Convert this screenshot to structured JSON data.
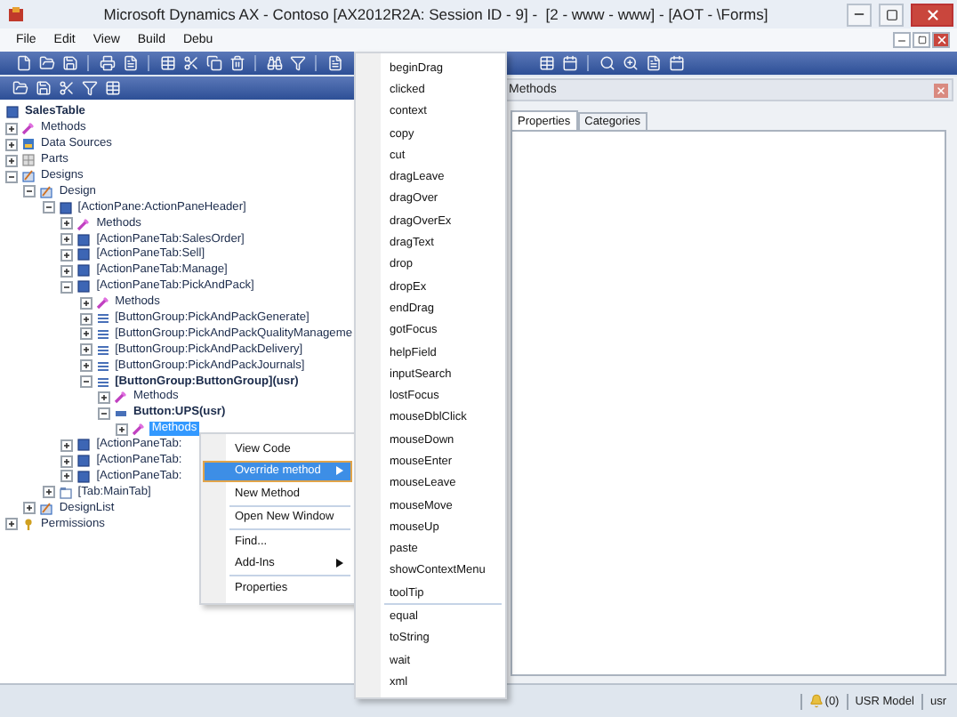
{
  "window": {
    "title": "Microsoft Dynamics AX - Contoso [AX2012R2A: Session ID - 9] -  [2 - www - www] - [AOT - \\Forms]"
  },
  "menu_bar": [
    "File",
    "Edit",
    "View",
    "Build",
    "Debu"
  ],
  "aot_tree": {
    "root": {
      "label": "SalesTable",
      "kind": "form",
      "bold": true,
      "children": [
        {
          "label": "Methods",
          "kind": "methods",
          "expanded": false
        },
        {
          "label": "Data Sources",
          "kind": "datasources",
          "expanded": false
        },
        {
          "label": "Parts",
          "kind": "parts",
          "expanded": false
        },
        {
          "label": "Designs",
          "kind": "designs",
          "expanded": true,
          "children": [
            {
              "label": "Design",
              "kind": "design",
              "expanded": true,
              "children": [
                {
                  "label": "[ActionPane:ActionPaneHeader]",
                  "kind": "actionpane",
                  "expanded": true,
                  "children": [
                    {
                      "label": "Methods",
                      "kind": "methods",
                      "expanded": false
                    },
                    {
                      "label": "[ActionPaneTab:SalesOrder]",
                      "kind": "actionpanetab",
                      "expanded": false
                    },
                    {
                      "label": "[ActionPaneTab:Sell]",
                      "kind": "actionpanetab",
                      "expanded": false
                    },
                    {
                      "label": "[ActionPaneTab:Manage]",
                      "kind": "actionpanetab",
                      "expanded": false
                    },
                    {
                      "label": "[ActionPaneTab:PickAndPack]",
                      "kind": "actionpanetab",
                      "expanded": true,
                      "children": [
                        {
                          "label": "Methods",
                          "kind": "methods",
                          "expanded": false
                        },
                        {
                          "label": "[ButtonGroup:PickAndPackGenerate]",
                          "kind": "buttongroup",
                          "expanded": false
                        },
                        {
                          "label": "[ButtonGroup:PickAndPackQualityManageme",
                          "kind": "buttongroup",
                          "expanded": false
                        },
                        {
                          "label": "[ButtonGroup:PickAndPackDelivery]",
                          "kind": "buttongroup",
                          "expanded": false
                        },
                        {
                          "label": "[ButtonGroup:PickAndPackJournals]",
                          "kind": "buttongroup",
                          "expanded": false
                        },
                        {
                          "label": "[ButtonGroup:ButtonGroup](usr)",
                          "kind": "buttongroup",
                          "bold": true,
                          "expanded": true,
                          "children": [
                            {
                              "label": "Methods",
                              "kind": "methods",
                              "expanded": false
                            },
                            {
                              "label": "Button:UPS(usr)",
                              "kind": "button",
                              "bold": true,
                              "expanded": true,
                              "children": [
                                {
                                  "label": "Methods",
                                  "kind": "methods",
                                  "expanded": false,
                                  "selected": true
                                }
                              ]
                            }
                          ]
                        }
                      ]
                    },
                    {
                      "label": "[ActionPaneTab:",
                      "kind": "actionpanetab",
                      "expanded": false
                    },
                    {
                      "label": "[ActionPaneTab:",
                      "kind": "actionpanetab",
                      "expanded": false
                    },
                    {
                      "label": "[ActionPaneTab:",
                      "kind": "actionpanetab",
                      "expanded": false
                    }
                  ]
                },
                {
                  "label": "[Tab:MainTab]",
                  "kind": "tab",
                  "expanded": false
                }
              ]
            },
            {
              "label": "DesignList",
              "kind": "design",
              "expanded": false
            }
          ]
        },
        {
          "label": "Permissions",
          "kind": "permissions",
          "expanded": false
        }
      ]
    }
  },
  "context_menu": {
    "groups": [
      [
        {
          "label": "View Code",
          "selected": false,
          "submenu": false
        },
        {
          "label": "Override method",
          "selected": true,
          "submenu": true
        },
        {
          "label": "New Method",
          "selected": false,
          "submenu": false
        }
      ],
      [
        {
          "label": "Open New Window",
          "selected": false,
          "submenu": false
        }
      ],
      [
        {
          "label": "Find...",
          "selected": false,
          "submenu": false
        },
        {
          "label": "Add-Ins",
          "selected": false,
          "submenu": true
        }
      ],
      [
        {
          "label": "Properties",
          "selected": false,
          "submenu": false
        }
      ]
    ]
  },
  "submenu": {
    "groups": [
      [
        "beginDrag",
        "clicked",
        "context",
        "copy",
        "cut",
        "dragLeave",
        "dragOver",
        "dragOverEx",
        "dragText",
        "drop",
        "dropEx",
        "endDrag",
        "gotFocus",
        "helpField",
        "inputSearch",
        "lostFocus",
        "mouseDblClick",
        "mouseDown",
        "mouseEnter",
        "mouseLeave",
        "mouseMove",
        "mouseUp",
        "paste",
        "showContextMenu",
        "toolTip"
      ],
      [
        "equal",
        "toString",
        "wait",
        "xml"
      ]
    ]
  },
  "property_pane": {
    "title": "Methods",
    "tabs": [
      {
        "label": "Properties",
        "selected": true
      },
      {
        "label": "Categories",
        "selected": false
      }
    ]
  },
  "status_bar": {
    "alerts": "(0)",
    "model": "USR Model",
    "layer": "usr"
  }
}
